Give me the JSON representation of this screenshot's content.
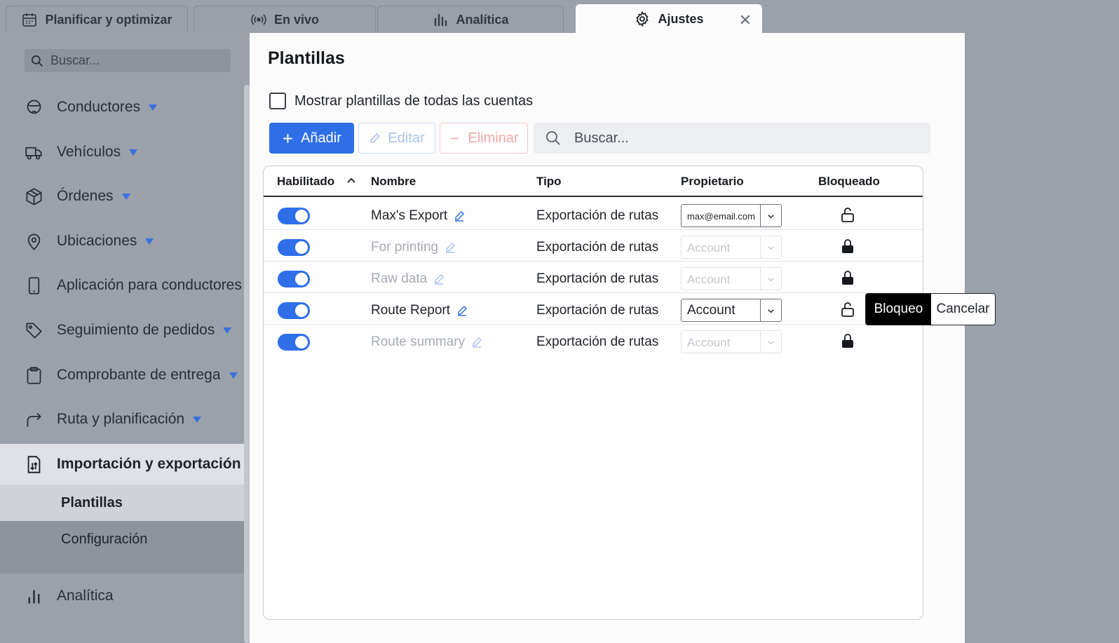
{
  "tabs": [
    {
      "label": "Planificar y optimizar",
      "icon": "calendar-icon",
      "active": false
    },
    {
      "label": "En vivo",
      "icon": "broadcast-icon",
      "active": false
    },
    {
      "label": "Analítica",
      "icon": "bar-chart-icon",
      "active": false
    },
    {
      "label": "Ajustes",
      "icon": "gear-icon",
      "active": true
    }
  ],
  "tab_close_glyph": "✕",
  "sidebar": {
    "search_placeholder": "Buscar...",
    "items": [
      {
        "label": "Conductores",
        "icon": "driver-icon"
      },
      {
        "label": "Vehículos",
        "icon": "truck-icon"
      },
      {
        "label": "Órdenes",
        "icon": "box-icon"
      },
      {
        "label": "Ubicaciones",
        "icon": "location-pin-icon"
      },
      {
        "label": "Aplicación para conductores",
        "icon": "phone-icon"
      },
      {
        "label": "Seguimiento de pedidos",
        "icon": "tag-icon"
      },
      {
        "label": "Comprobante de entrega",
        "icon": "clipboard-icon"
      },
      {
        "label": "Ruta y planificación",
        "icon": "route-arrow-icon"
      },
      {
        "label": "Importación y exportación",
        "icon": "import-export-icon",
        "expanded": true
      },
      {
        "label": "Analítica",
        "icon": "bar-chart-icon"
      }
    ],
    "subitems": [
      {
        "label": "Plantillas",
        "selected": true
      },
      {
        "label": "Configuración",
        "selected": false
      }
    ]
  },
  "main": {
    "title": "Plantillas",
    "show_all_label": "Mostrar plantillas de todas las cuentas",
    "show_all_checked": false,
    "buttons": {
      "add": "Añadir",
      "edit": "Editar",
      "delete": "Eliminar"
    },
    "search_placeholder": "Buscar...",
    "columns": [
      "Habilitado",
      "Nombre",
      "Tipo",
      "Propietario",
      "Bloqueado"
    ],
    "rows": [
      {
        "enabled": true,
        "name": "Max's Export",
        "type": "Exportación de rutas",
        "owner": "max@email.com",
        "locked": false,
        "muted": false
      },
      {
        "enabled": true,
        "name": "For printing",
        "type": "Exportación de rutas",
        "owner": "Account",
        "locked": true,
        "muted": true
      },
      {
        "enabled": true,
        "name": "Raw data",
        "type": "Exportación de rutas",
        "owner": "Account",
        "locked": true,
        "muted": true
      },
      {
        "enabled": true,
        "name": "Route Report",
        "type": "Exportación de rutas",
        "owner": "Account",
        "locked": false,
        "muted": false
      },
      {
        "enabled": true,
        "name": "Route summary",
        "type": "Exportación de rutas",
        "owner": "Account",
        "locked": true,
        "muted": true
      }
    ],
    "lock_popover": {
      "confirm": "Bloqueo",
      "cancel": "Cancelar"
    }
  },
  "colors": {
    "accent": "#2e6fe8",
    "background": "#9ba1ab",
    "panel": "#fbfbfb"
  }
}
